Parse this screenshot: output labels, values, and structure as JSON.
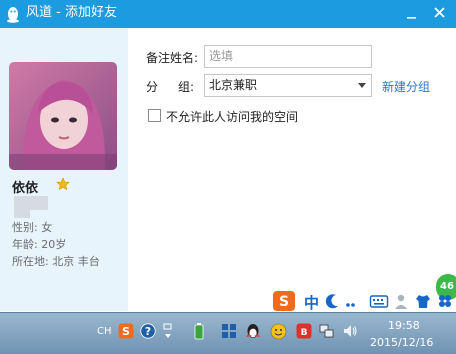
{
  "window": {
    "title": "风道 - 添加好友"
  },
  "profile": {
    "nickname": "依依",
    "gender": "性别: 女",
    "age": "年龄: 20岁",
    "location": "所在地: 北京  丰台"
  },
  "form": {
    "remark_label": "备注姓名:",
    "remark_placeholder": "选填",
    "group_label_a": "分",
    "group_label_b": "组:",
    "group_value": "北京兼职",
    "new_group_link": "新建分组",
    "privacy_checkbox_label": "不允许此人访问我的空间"
  },
  "ime_bar": {
    "mode": "中"
  },
  "notification_badge": "46",
  "taskbar": {
    "lang": "CH",
    "time": "19:58",
    "date": "2015/12/16"
  },
  "colors": {
    "titlebar": "#1c9be0",
    "left_panel": "#e8f4fb",
    "link": "#2a77c9"
  }
}
